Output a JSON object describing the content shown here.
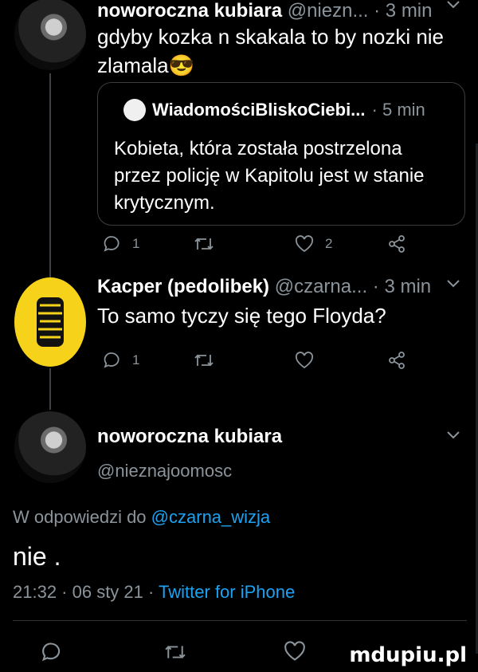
{
  "tweet1": {
    "name": "noworoczna kubiara",
    "handle": "@niezn...",
    "time": "· 3 min",
    "text_line1": "gdyby kozka n skakala to by nozki nie",
    "text_line2": "zlamala😎",
    "quote": {
      "name": "WiadomościBliskoCiebi...",
      "time": "· 5 min",
      "line1": "Kobieta, która została postrzelona",
      "line2": "przez policję w Kapitolu jest w stanie",
      "line3": "krytycznym."
    },
    "reply_count": "1",
    "like_count": "2"
  },
  "tweet2": {
    "name": "Kacper (pedolibek)",
    "handle": "@czarna...",
    "time": "· 3 min",
    "text": "To samo tyczy się tego Floyda?",
    "reply_count": "1"
  },
  "main": {
    "name": "noworoczna kubiara",
    "handle": "@nieznajoomosc",
    "reply_prefix": "W odpowiedzi do",
    "reply_handle": "@czarna_wizja",
    "text": "nie .",
    "meta_prefix": "21:32 · 06 sty 21 ·",
    "source": "Twitter for iPhone"
  },
  "watermark": "mdupiu.pl",
  "icons": [
    "reply-icon",
    "retweet-icon",
    "like-icon",
    "share-icon",
    "chevron-down-icon"
  ],
  "colors": {
    "background": "#000000",
    "link": "#1da1f2",
    "muted": "#8b949b",
    "tiger_avatar": "#f6d21a"
  }
}
